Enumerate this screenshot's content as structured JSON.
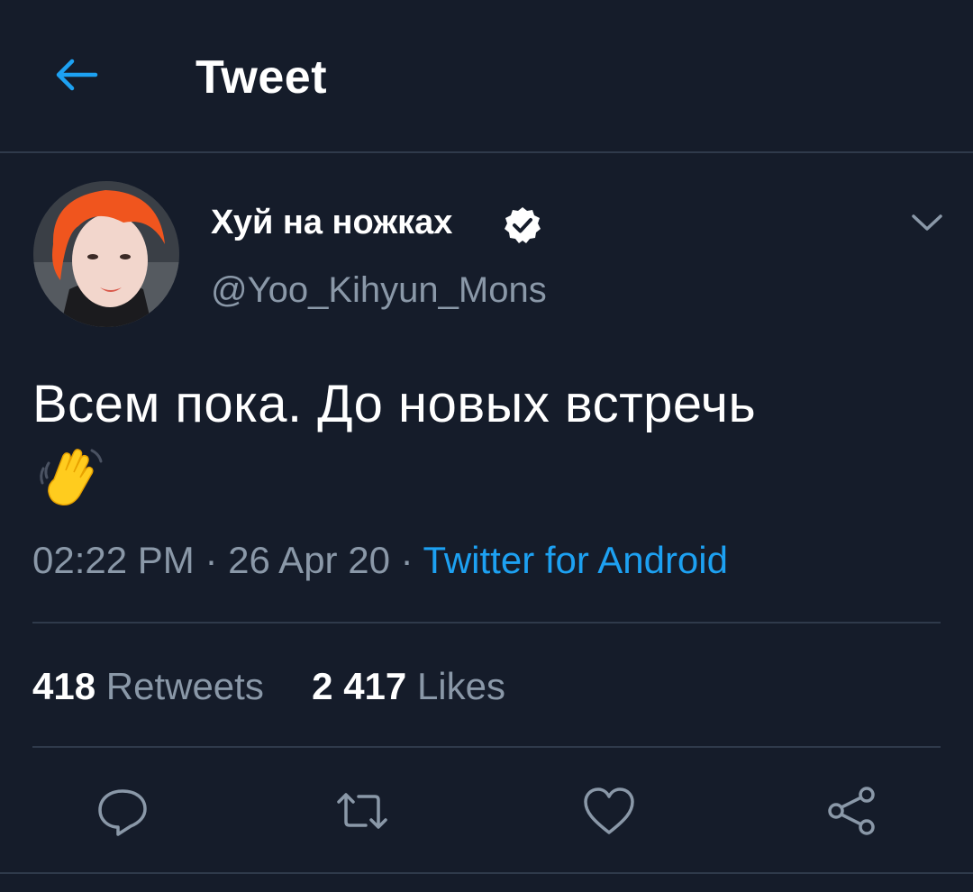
{
  "header": {
    "title": "Tweet"
  },
  "author": {
    "display_name": "Хуй на ножках",
    "handle": "@Yoo_Kihyun_Mons",
    "verified": true
  },
  "tweet": {
    "text": "Всем пока. До новых встречь",
    "emoji": "waving-hand",
    "time": "02:22 PM",
    "sep1": " · ",
    "date": "26 Apr 20",
    "sep2": " · ",
    "source": "Twitter for Android"
  },
  "stats": {
    "retweets_count": "418",
    "retweets_label": "Retweets",
    "likes_count": "2 417",
    "likes_label": "Likes"
  },
  "actions": [
    "reply-icon",
    "retweet-icon",
    "like-icon",
    "share-icon"
  ],
  "colors": {
    "background": "#151c2a",
    "accent": "#1da1f2",
    "muted_text": "#8a98a8",
    "divider": "#2f3a4b",
    "hair": "#f0551e"
  }
}
